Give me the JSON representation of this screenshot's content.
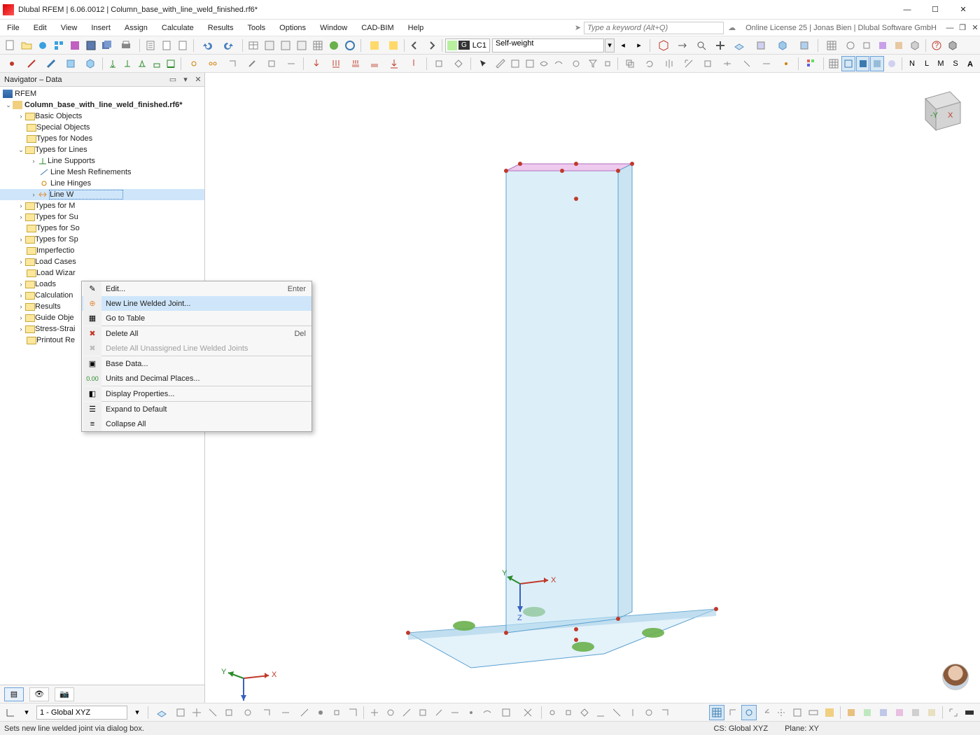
{
  "window": {
    "title": "Dlubal RFEM | 6.06.0012 | Column_base_with_line_weld_finished.rf6*",
    "min": "—",
    "max": "☐",
    "close": "✕"
  },
  "menu": {
    "items": [
      "File",
      "Edit",
      "View",
      "Insert",
      "Assign",
      "Calculate",
      "Results",
      "Tools",
      "Options",
      "Window",
      "CAD-BIM",
      "Help"
    ],
    "search_placeholder": "Type a keyword (Alt+Q)",
    "license": "Online License 25 | Jonas Bien | Dlubal Software GmbH"
  },
  "loadcase": {
    "badge": "G",
    "code": "LC1",
    "name": "Self-weight"
  },
  "navigator": {
    "title": "Navigator – Data",
    "root": "RFEM",
    "model": "Column_base_with_line_weld_finished.rf6*",
    "nodes": {
      "basic": "Basic Objects",
      "special": "Special Objects",
      "types_nodes": "Types for Nodes",
      "types_lines": "Types for Lines",
      "line_supports": "Line Supports",
      "line_mesh": "Line Mesh Refinements",
      "line_hinges": "Line Hinges",
      "line_welded": "Line Welded Joints",
      "types_m": "Types for M",
      "types_s1": "Types for Su",
      "types_s2": "Types for So",
      "types_sp": "Types for Sp",
      "imperf": "Imperfectio",
      "load_cases": "Load Cases",
      "load_wiz": "Load Wizar",
      "loads": "Loads",
      "calc": "Calculation",
      "results": "Results",
      "guide": "Guide Obje",
      "stress": "Stress-Strai",
      "printout": "Printout Re"
    }
  },
  "context": {
    "edit": "Edit...",
    "edit_key": "Enter",
    "new_welded": "New Line Welded Joint...",
    "goto": "Go to Table",
    "delete_all": "Delete All",
    "delete_key": "Del",
    "delete_unassigned": "Delete All Unassigned Line Welded Joints",
    "base_data": "Base Data...",
    "units": "Units and Decimal Places...",
    "display": "Display Properties...",
    "expand": "Expand to Default",
    "collapse": "Collapse All"
  },
  "bottom": {
    "cs_select": "1 - Global XYZ"
  },
  "status": {
    "hint": "Sets new line welded joint via dialog box.",
    "cs": "CS: Global XYZ",
    "plane": "Plane: XY"
  }
}
